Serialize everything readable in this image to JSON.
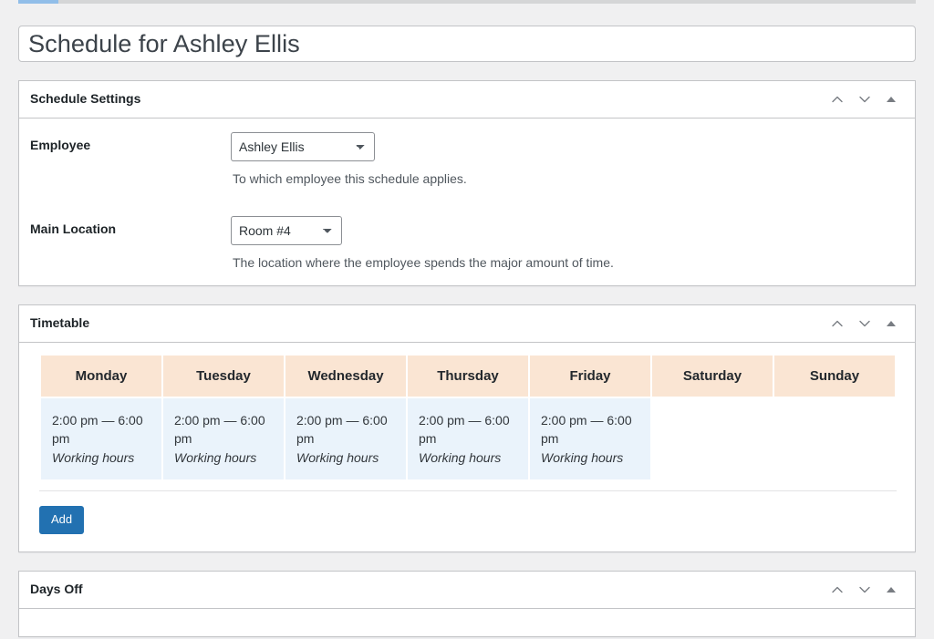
{
  "page": {
    "title_value": "Schedule for Ashley Ellis",
    "title_placeholder": "Add title"
  },
  "icons": {
    "order_up": "chevron-up-icon",
    "order_down": "chevron-down-icon",
    "toggle": "triangle-up-icon"
  },
  "panels": {
    "schedule_settings": {
      "title": "Schedule Settings",
      "fields": [
        {
          "label": "Employee",
          "control": "select",
          "value": "Ashley Ellis",
          "options": [
            "Ashley Ellis"
          ],
          "description": "To which employee this schedule applies."
        },
        {
          "label": "Main Location",
          "control": "select",
          "value": "Room #4",
          "options": [
            "Room #4"
          ],
          "description": "The location where the employee spends the major amount of time."
        }
      ]
    },
    "timetable": {
      "title": "Timetable",
      "days": [
        "Monday",
        "Tuesday",
        "Wednesday",
        "Thursday",
        "Friday",
        "Saturday",
        "Sunday"
      ],
      "slots": [
        {
          "time": "2:00 pm — 6:00 pm",
          "label": "Working hours"
        },
        {
          "time": "2:00 pm — 6:00 pm",
          "label": "Working hours"
        },
        {
          "time": "2:00 pm — 6:00 pm",
          "label": "Working hours"
        },
        {
          "time": "2:00 pm — 6:00 pm",
          "label": "Working hours"
        },
        {
          "time": "2:00 pm — 6:00 pm",
          "label": "Working hours"
        },
        null,
        null
      ],
      "add_label": "Add"
    },
    "days_off": {
      "title": "Days Off"
    }
  },
  "colors": {
    "accent": "#2271b1",
    "day_header_bg": "#fae5d3",
    "slot_bg": "#eaf3fb",
    "page_bg": "#f0f0f1",
    "border": "#c3c4c7"
  }
}
